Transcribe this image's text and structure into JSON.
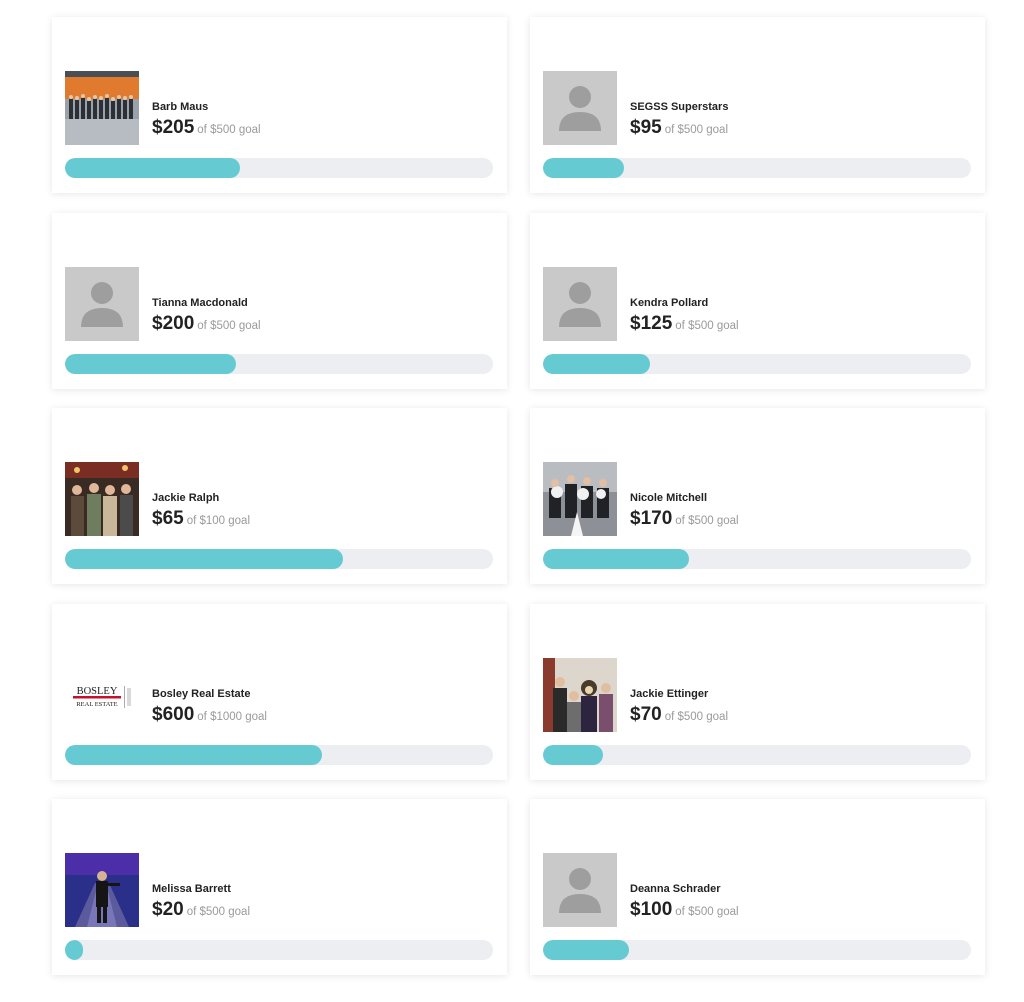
{
  "fundraisers": [
    {
      "name": "Barb Maus",
      "raised": "$205",
      "goal_text": "of $500 goal",
      "progress": 0.41,
      "photo": "photo-barb-maus"
    },
    {
      "name": "SEGSS Superstars",
      "raised": "$95",
      "goal_text": "of $500 goal",
      "progress": 0.19,
      "photo": "default-avatar-icon"
    },
    {
      "name": "Tianna Macdonald",
      "raised": "$200",
      "goal_text": "of $500 goal",
      "progress": 0.4,
      "photo": "default-avatar-icon"
    },
    {
      "name": "Kendra Pollard",
      "raised": "$125",
      "goal_text": "of $500 goal",
      "progress": 0.25,
      "photo": "default-avatar-icon"
    },
    {
      "name": "Jackie Ralph",
      "raised": "$65",
      "goal_text": "of $100 goal",
      "progress": 0.65,
      "photo": "photo-jackie-ralph"
    },
    {
      "name": "Nicole Mitchell",
      "raised": "$170",
      "goal_text": "of $500 goal",
      "progress": 0.34,
      "photo": "photo-nicole-mitchell"
    },
    {
      "name": "Bosley Real Estate",
      "raised": "$600",
      "goal_text": "of $1000 goal",
      "progress": 0.6,
      "photo": "logo-bosley",
      "logo_line1": "BOSLEY",
      "logo_line2": "REAL ESTATE"
    },
    {
      "name": "Jackie Ettinger",
      "raised": "$70",
      "goal_text": "of $500 goal",
      "progress": 0.14,
      "photo": "photo-jackie-ettinger"
    },
    {
      "name": "Melissa Barrett",
      "raised": "$20",
      "goal_text": "of $500 goal",
      "progress": 0.04,
      "photo": "photo-melissa-barrett"
    },
    {
      "name": "Deanna Schrader",
      "raised": "$100",
      "goal_text": "of $500 goal",
      "progress": 0.2,
      "photo": "default-avatar-icon"
    }
  ],
  "colors": {
    "progress_fill": "#66cad3",
    "progress_track": "#eceef2",
    "avatar_bg": "#c9c9c9",
    "avatar_glyph": "#9e9e9e",
    "logo_red": "#c8102e"
  }
}
